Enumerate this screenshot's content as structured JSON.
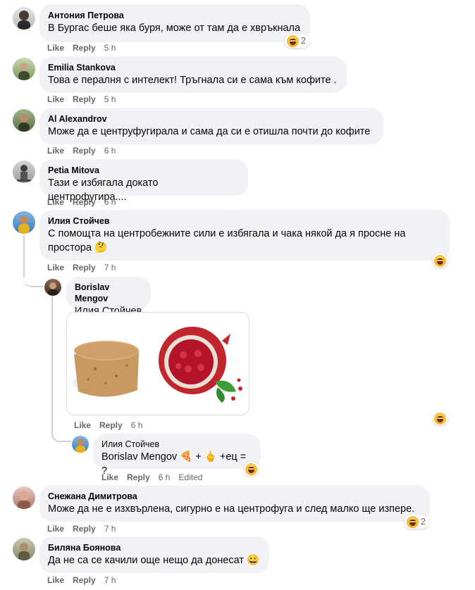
{
  "comments": [
    {
      "name": "Антония Петрова",
      "text": "В Бургас беше яка буря, може от там да е хвръкнала",
      "like": "Like",
      "reply": "Reply",
      "time": "5 h",
      "reactions": "2"
    },
    {
      "name": "Emilia Stankova",
      "text": "Това е пералня с интелект! Тръгнала си е сама към кофите .",
      "like": "Like",
      "reply": "Reply",
      "time": "5 h"
    },
    {
      "name": "Al Alexandrov",
      "text": "Може да е центруфугирала и сама да си е отишла почти до кофите",
      "like": "Like",
      "reply": "Reply",
      "time": "6 h"
    },
    {
      "name": "Petia Mitova",
      "text": "Тази е избягала докато центрофугира....",
      "like": "Like",
      "reply": "Reply",
      "time": "6 h"
    },
    {
      "name": "Илия Стойчев",
      "text_line1": "С помощта на центробежните сили е избягала и чака някой да я просне на",
      "text_line2": "простора",
      "emoji_thinking": "🤔",
      "like": "Like",
      "reply": "Reply",
      "time": "7 h"
    },
    {
      "name": "Borislav Mengov",
      "mention": "Илия Стойчев",
      "like": "Like",
      "reply": "Reply",
      "time": "6 h"
    },
    {
      "name": "Илия Стойчев",
      "mention": "Borislav Mengov",
      "rest": "🍕 + 🖕 +ец = ?",
      "like": "Like",
      "reply": "Reply",
      "time": "6 h",
      "edited": "Edited"
    },
    {
      "name": "Снежана Димитрова",
      "text": "Може да не е изхвърлена, сигурно е на центрофуга и след малко ще изпере.",
      "like": "Like",
      "reply": "Reply",
      "time": "7 h",
      "reactions": "2"
    },
    {
      "name": "Биляна Боянова",
      "text": "Да не са се качили още нещо да донесат",
      "emoji_smile": "😀",
      "like": "Like",
      "reply": "Reply",
      "time": "7 h"
    }
  ],
  "colors": {
    "bubble": "#f0f2f5",
    "meta": "#65676b",
    "reaction": "#f7b125"
  },
  "icons": [
    "laugh-reaction-icon",
    "cork-image",
    "pomegranate-image"
  ]
}
